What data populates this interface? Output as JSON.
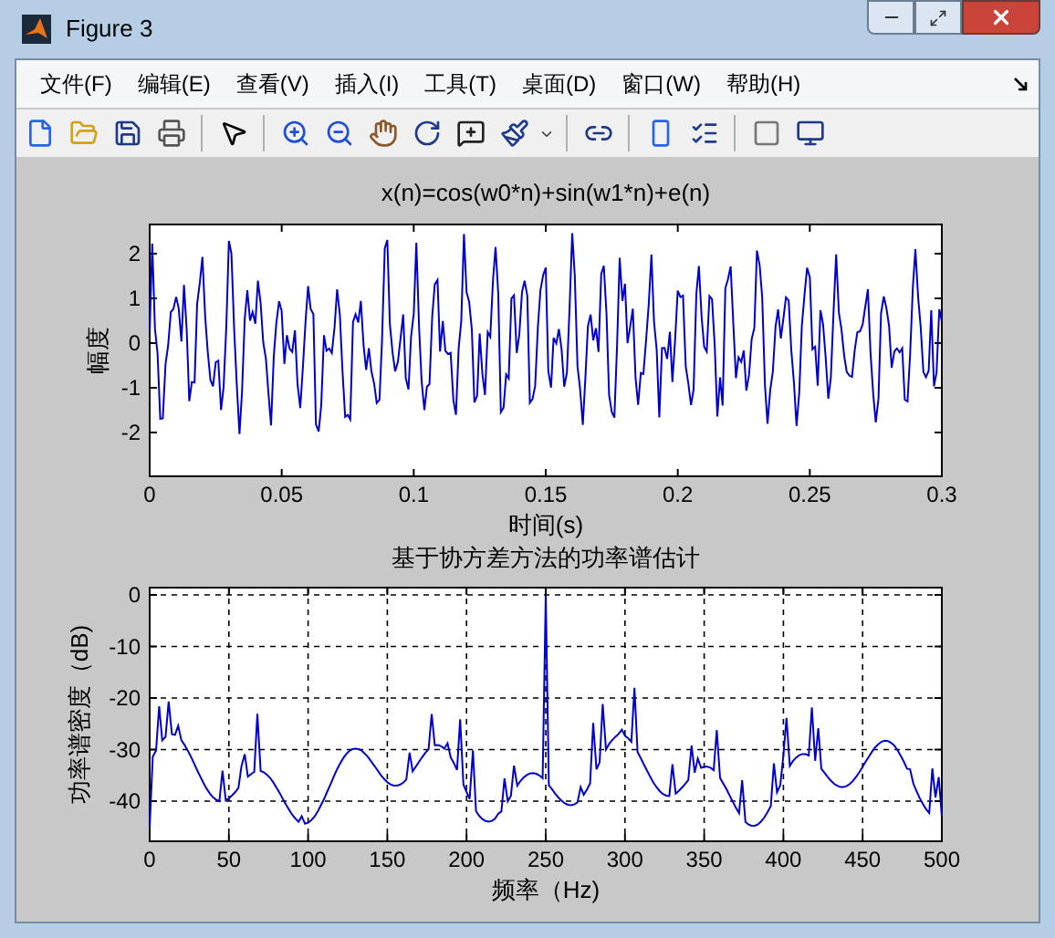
{
  "window": {
    "title": "Figure 3"
  },
  "menu": [
    "文件(F)",
    "编辑(E)",
    "查看(V)",
    "插入(I)",
    "工具(T)",
    "桌面(D)",
    "窗口(W)",
    "帮助(H)"
  ],
  "plots": [
    {
      "kind": "signal",
      "grid": false,
      "title": "x(n)=cos(w0*n)+sin(w1*n)+e(n)",
      "xlabel": "时间(s)",
      "ylabel": "幅度",
      "xticks": [
        "0",
        "0.05",
        "0.1",
        "0.15",
        "0.2",
        "0.25",
        "0.3"
      ],
      "yticks": [
        "2",
        "1",
        "0",
        "-1",
        "-2"
      ]
    },
    {
      "kind": "spectrum",
      "grid": true,
      "title": "基于协方差方法的功率谱估计",
      "xlabel": "频率（Hz)",
      "ylabel": "功率谱密度（dB)",
      "xticks": [
        "0",
        "50",
        "100",
        "150",
        "200",
        "250",
        "300",
        "350",
        "400",
        "450",
        "500"
      ],
      "yticks": [
        "0",
        "-10",
        "-20",
        "-30",
        "-40"
      ]
    }
  ]
}
